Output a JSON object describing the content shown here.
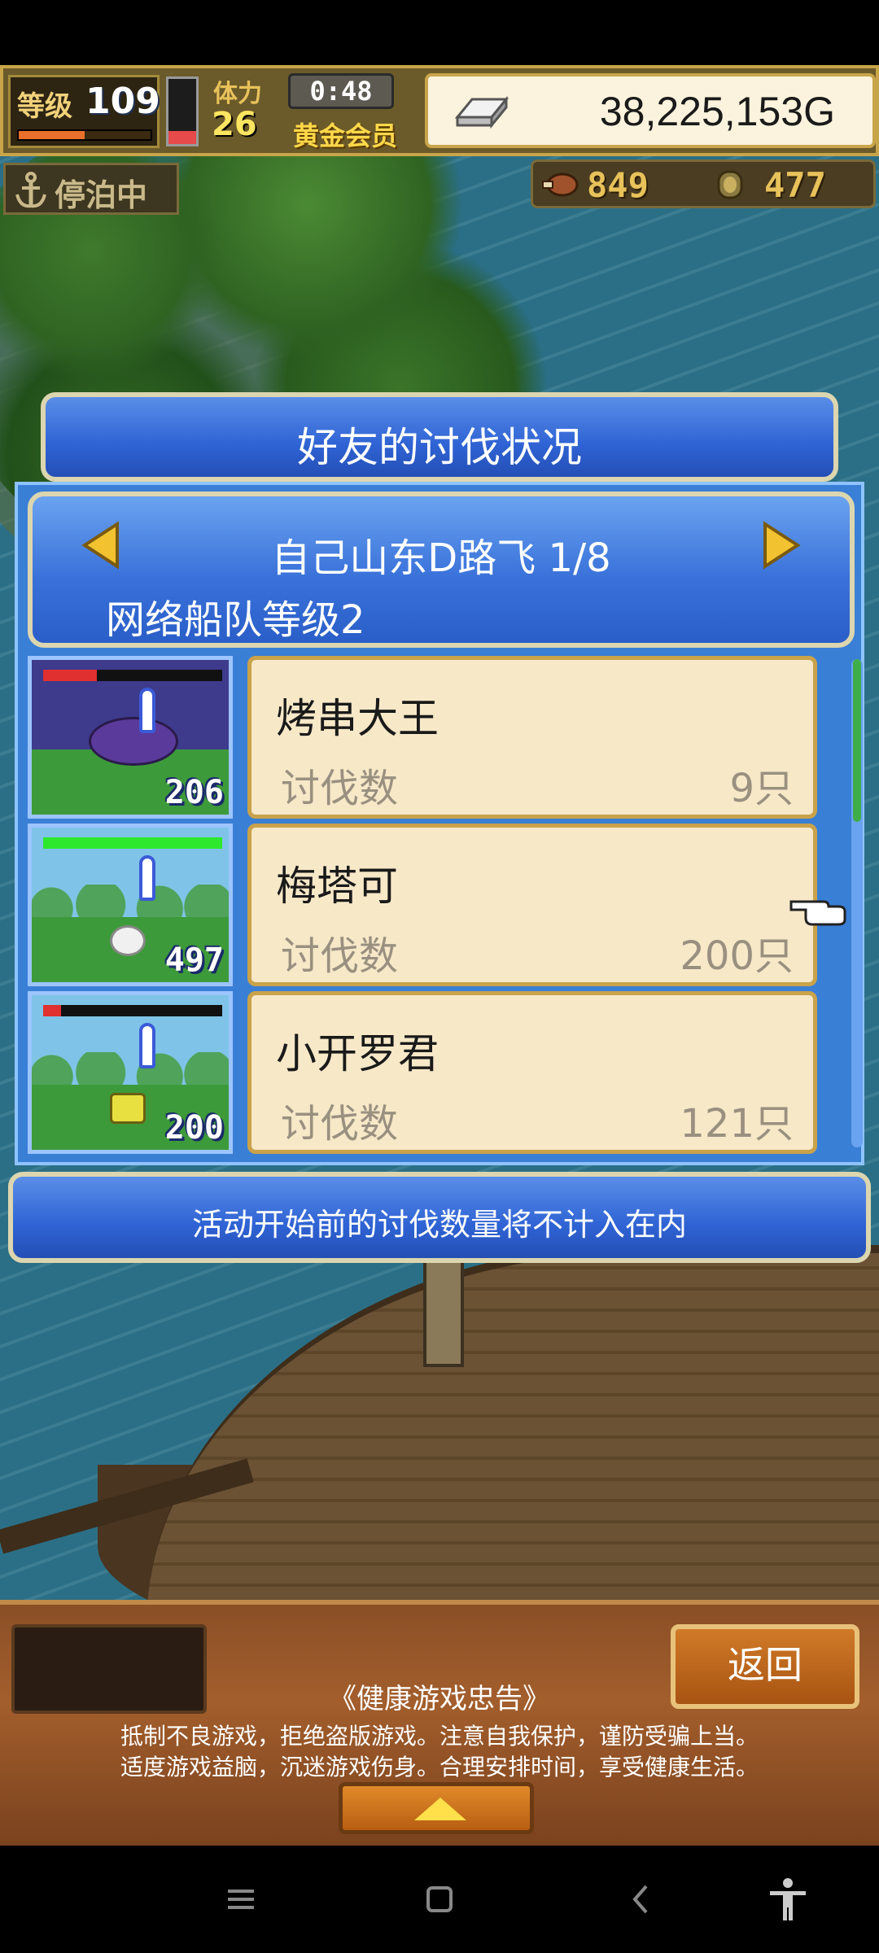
{
  "hud": {
    "level_label": "等级",
    "level_value": "109",
    "xp_fraction": 0.5,
    "stamina_label": "体力",
    "stamina_value": "26",
    "stamina_fraction": 0.2,
    "timer": "0:48",
    "membership": "黄金会员",
    "money": "38,225,153G"
  },
  "status": {
    "docked_label": "停泊中"
  },
  "resources": {
    "food": "849",
    "wood": "477"
  },
  "panel": {
    "title": "好友的讨伐状况",
    "player_name": "自己山东D路飞 1/8",
    "fleet_level": "网络船队等级2",
    "rows": [
      {
        "name": "烤串大王",
        "kill_label": "讨伐数",
        "kill_value": "9只",
        "thumb_number": "206",
        "hp_fraction": 0.3,
        "hp_color": "#e03030"
      },
      {
        "name": "梅塔可",
        "kill_label": "讨伐数",
        "kill_value": "200只",
        "thumb_number": "497",
        "hp_fraction": 1.0,
        "hp_color": "#2ee82e"
      },
      {
        "name": "小开罗君",
        "kill_label": "讨伐数",
        "kill_value": "121只",
        "thumb_number": "200",
        "hp_fraction": 0.1,
        "hp_color": "#e03030"
      }
    ],
    "notice": "活动开始前的讨伐数量将不计入在内"
  },
  "footer": {
    "back_label": "返回",
    "health_title": "《健康游戏忠告》",
    "health_line1": "抵制不良游戏，拒绝盗版游戏。注意自我保护，谨防受骗上当。",
    "health_line2": "适度游戏益脑，沉迷游戏伤身。合理安排时间，享受健康生活。"
  },
  "icons": {
    "anchor": "anchor-icon",
    "money": "silver-bar-icon",
    "food": "meat-icon",
    "wood": "log-icon",
    "prev": "left-arrow-icon",
    "next": "right-arrow-icon",
    "pointer": "pointing-hand-icon"
  }
}
